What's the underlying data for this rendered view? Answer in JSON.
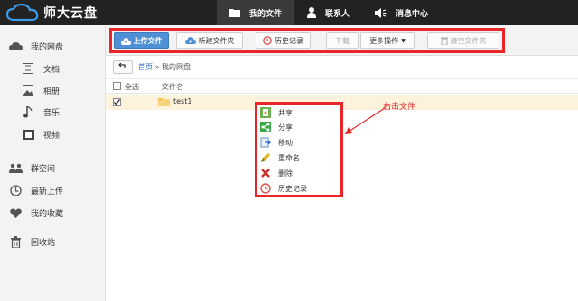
{
  "app": {
    "logo_text": "师大云盘"
  },
  "topnav": [
    {
      "label": "我的文件",
      "icon": "folder-icon",
      "active": true
    },
    {
      "label": "联系人",
      "icon": "user-icon",
      "active": false
    },
    {
      "label": "消息中心",
      "icon": "speaker-icon",
      "active": false
    }
  ],
  "sidebar": {
    "items": [
      {
        "label": "我的网盘",
        "icon": "cloud-icon"
      },
      {
        "label": "文档",
        "icon": "document-icon"
      },
      {
        "label": "相册",
        "icon": "image-icon"
      },
      {
        "label": "音乐",
        "icon": "music-icon"
      },
      {
        "label": "视频",
        "icon": "film-icon"
      },
      {
        "label": "群空间",
        "icon": "group-icon"
      },
      {
        "label": "最新上传",
        "icon": "clock-icon"
      },
      {
        "label": "我的收藏",
        "icon": "heart-icon"
      },
      {
        "label": "回收站",
        "icon": "trash-icon"
      }
    ]
  },
  "toolbar": {
    "upload_label": "上传文件",
    "new_folder_label": "新建文件夹",
    "history_label": "历史记录",
    "download_label": "下载",
    "more_label": "更多操作",
    "empty_label": "清空文件夹"
  },
  "breadcrumb": {
    "home": "首页",
    "separator": "»",
    "current": "我的网盘"
  },
  "table": {
    "select_all_label": "全选",
    "filename_header": "文件名",
    "rows": [
      {
        "name": "test1",
        "checked": true
      }
    ]
  },
  "context_menu": {
    "items": [
      {
        "label": "共享",
        "icon": "share-icon"
      },
      {
        "label": "分享",
        "icon": "link-share-icon"
      },
      {
        "label": "移动",
        "icon": "move-icon"
      },
      {
        "label": "重命名",
        "icon": "rename-icon"
      },
      {
        "label": "删除",
        "icon": "delete-icon"
      },
      {
        "label": "历史记录",
        "icon": "history-icon"
      }
    ]
  },
  "annotation": {
    "text": "右击文件"
  },
  "colors": {
    "accent": "#4f8fd6",
    "highlight_box": "#e8262a",
    "selected_row": "#fdf3dc",
    "topbar": "#222222"
  }
}
